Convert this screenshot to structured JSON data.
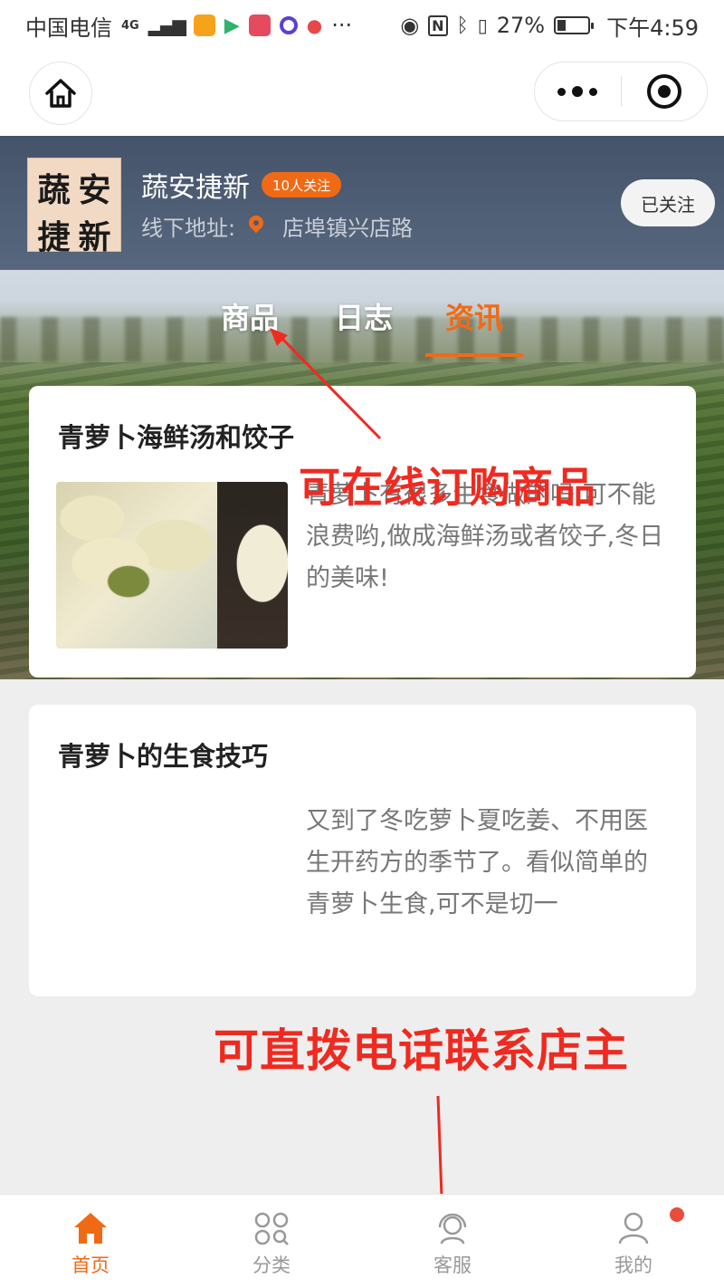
{
  "status_bar": {
    "carrier": "中国电信",
    "network": "4G",
    "battery_percent": "27%",
    "time": "下午4:59",
    "more": "···"
  },
  "shop": {
    "logo_chars": [
      "蔬",
      "安",
      "捷",
      "新"
    ],
    "name": "蔬安捷新",
    "follow_count": "10人关注",
    "address_label": "线下地址:",
    "address": "店埠镇兴店路",
    "followed_button": "已关注"
  },
  "tabs": [
    {
      "label": "商品",
      "active": false
    },
    {
      "label": "日志",
      "active": false
    },
    {
      "label": "资讯",
      "active": true
    }
  ],
  "articles": [
    {
      "title": "青萝卜海鲜汤和饺子",
      "excerpt": "青萝卜有很多生食做的吗,可不能浪费哟,做成海鲜汤或者饺子,冬日的美味!"
    },
    {
      "title": "青萝卜的生食技巧",
      "excerpt": "又到了冬吃萝卜夏吃姜、不用医生开药方的季节了。看似简单的青萝卜生食,可不是切一"
    }
  ],
  "annotations": {
    "top": "可在线订购商品",
    "bottom": "可直拨电话联系店主"
  },
  "tabbar": [
    {
      "label": "首页",
      "icon": "home-icon",
      "active": true
    },
    {
      "label": "分类",
      "icon": "category-icon",
      "active": false
    },
    {
      "label": "客服",
      "icon": "customer-service-icon",
      "active": false
    },
    {
      "label": "我的",
      "icon": "user-icon",
      "active": false
    }
  ],
  "colors": {
    "accent": "#f06a16",
    "annotation": "#ef2a20",
    "inactive": "#999999"
  }
}
